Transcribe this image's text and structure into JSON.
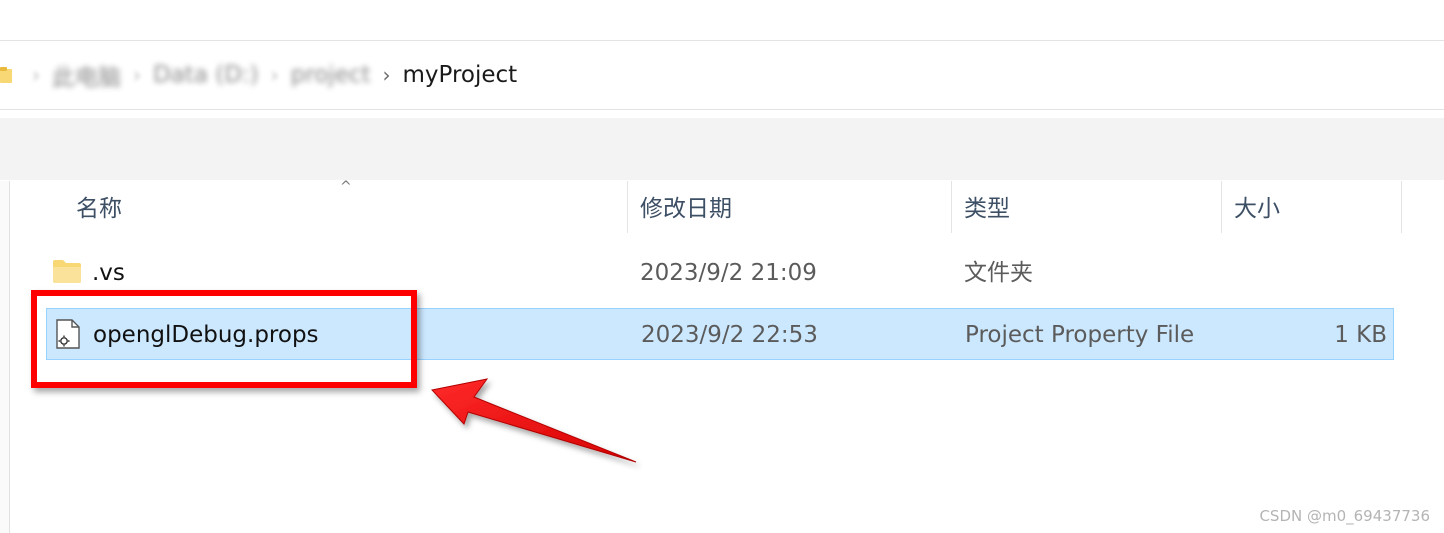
{
  "address_bar": {
    "breadcrumbs": [
      {
        "label": "此电脑"
      },
      {
        "label": "Data (D:)"
      },
      {
        "label": "project"
      }
    ],
    "current_folder": "myProject",
    "separator": "›"
  },
  "file_list": {
    "columns": {
      "name": "名称",
      "date_modified": "修改日期",
      "type": "类型",
      "size": "大小"
    },
    "sort_indicator": "^",
    "rows": [
      {
        "name": ".vs",
        "date_modified": "2023/9/2 21:09",
        "type": "文件夹",
        "size": "",
        "icon": "folder-icon",
        "selected": false
      },
      {
        "name": "openglDebug.props",
        "date_modified": "2023/9/2 22:53",
        "type": "Project Property File",
        "size": "1 KB",
        "icon": "property-file-icon",
        "selected": true
      }
    ]
  },
  "annotation": {
    "highlight_color": "#ff0000"
  },
  "watermark": "CSDN @m0_69437736",
  "colors": {
    "selection_bg": "#cce8ff",
    "selection_border": "#99d1ff",
    "folder_yellow": "#f8d775"
  }
}
